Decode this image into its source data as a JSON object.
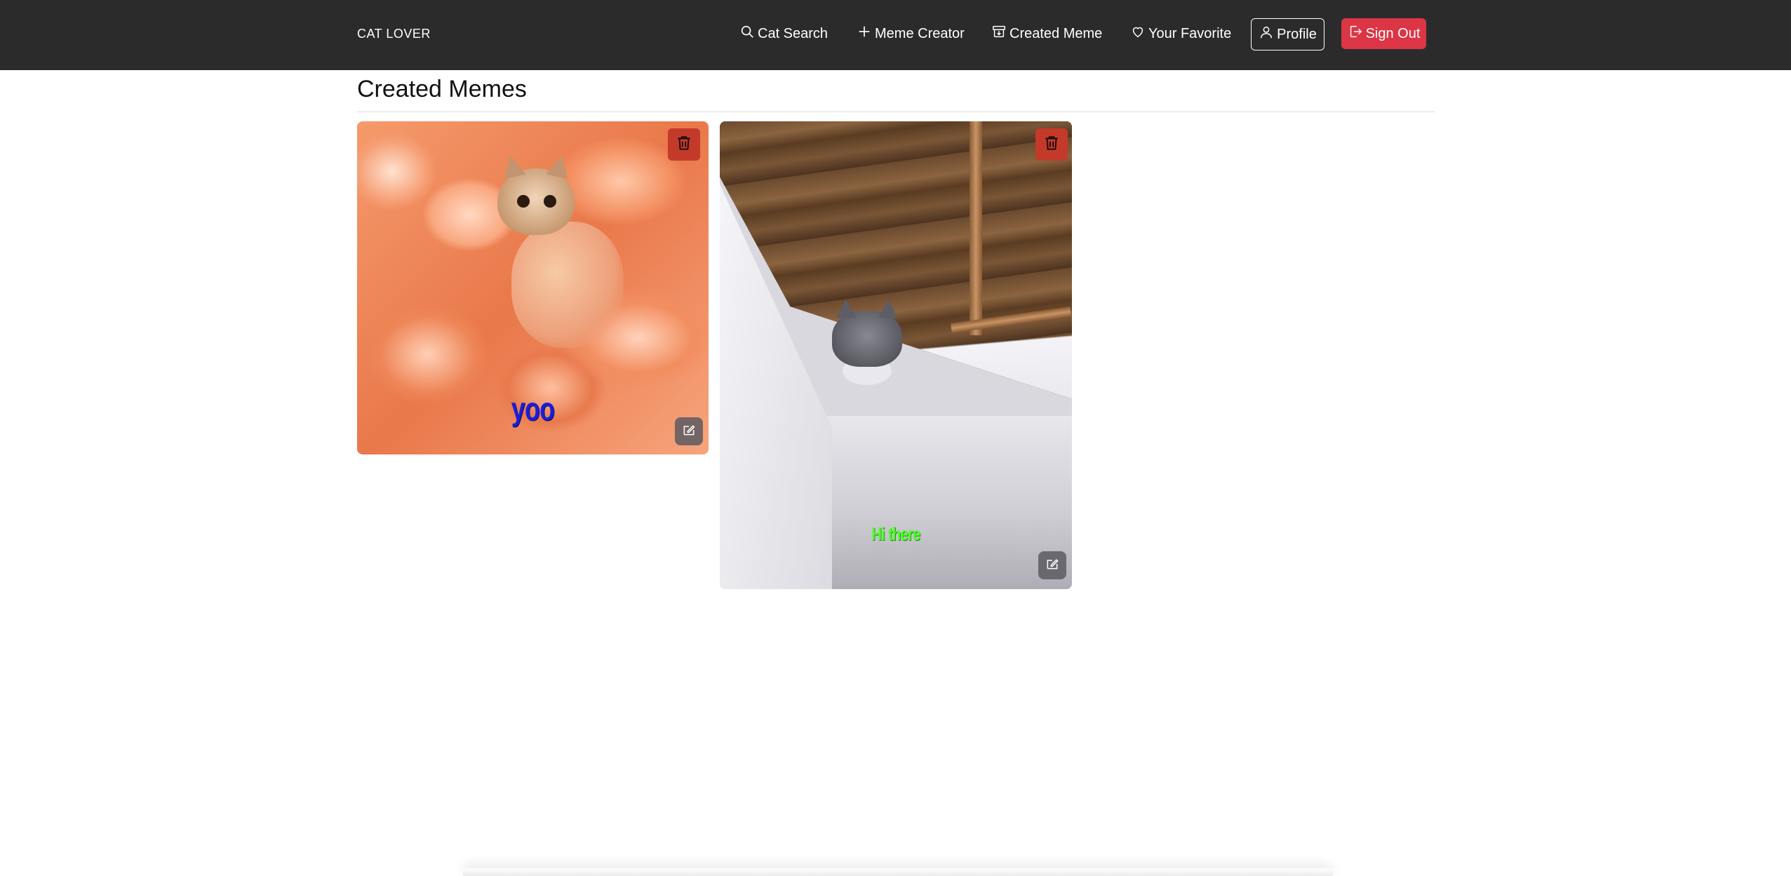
{
  "navbar": {
    "brand": "CAT LOVER",
    "links": [
      {
        "label": "Cat Search",
        "icon": "search-icon"
      },
      {
        "label": "Meme Creator",
        "icon": "plus-icon"
      },
      {
        "label": "Created Meme",
        "icon": "archive-icon"
      },
      {
        "label": "Your Favorite",
        "icon": "heart-icon"
      }
    ],
    "profile_label": "Profile",
    "signout_label": "Sign Out"
  },
  "page": {
    "title": "Created Memes"
  },
  "memes": [
    {
      "caption": "yoo",
      "caption_color": "#1a1ed8"
    },
    {
      "caption": "Hi there",
      "caption_color": "#4dff2a"
    }
  ],
  "colors": {
    "navbar_bg": "#2b2b2b",
    "signout_bg": "#dc3545",
    "delete_bg": "#c43a2a"
  }
}
